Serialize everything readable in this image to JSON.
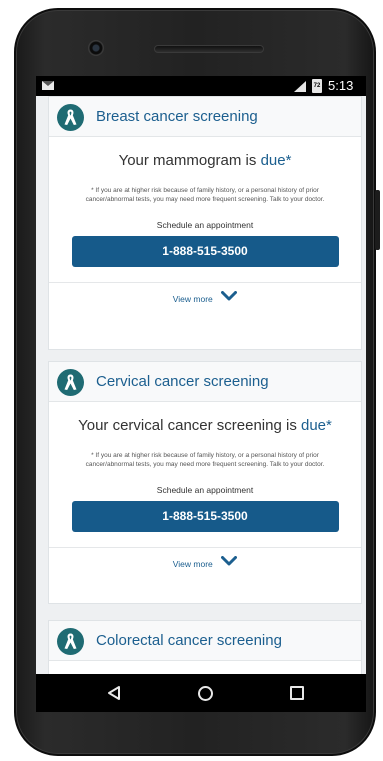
{
  "statusbar": {
    "time": "5:13",
    "battery_label": "72"
  },
  "cards": [
    {
      "title": "Breast cancer screening",
      "status_prefix": "Your mammogram is ",
      "status_due": "due*",
      "disclaimer": "* If you are at higher risk because of family history, or a personal history of prior cancer/abnormal tests, you may need more frequent screening. Talk to your doctor.",
      "schedule_label": "Schedule an appointment",
      "phone": "1-888-515-3500",
      "view_more": "View more"
    },
    {
      "title": "Cervical cancer screening",
      "status_prefix": "Your cervical cancer screening is ",
      "status_due": "due*",
      "disclaimer": "* If you are at higher risk because of family history, or a personal history of prior cancer/abnormal tests, you may need more frequent screening. Talk to your doctor.",
      "schedule_label": "Schedule an appointment",
      "phone": "1-888-515-3500",
      "view_more": "View more"
    },
    {
      "title": "Colorectal cancer screening"
    }
  ],
  "icons": {
    "card": "awareness-ribbon-icon",
    "expand": "chevron-down-icon",
    "nav": [
      "back-icon",
      "home-icon",
      "recent-apps-icon"
    ]
  },
  "colors": {
    "accent": "#1c5f8f",
    "button": "#165a8a",
    "badge": "#1f6b73"
  }
}
